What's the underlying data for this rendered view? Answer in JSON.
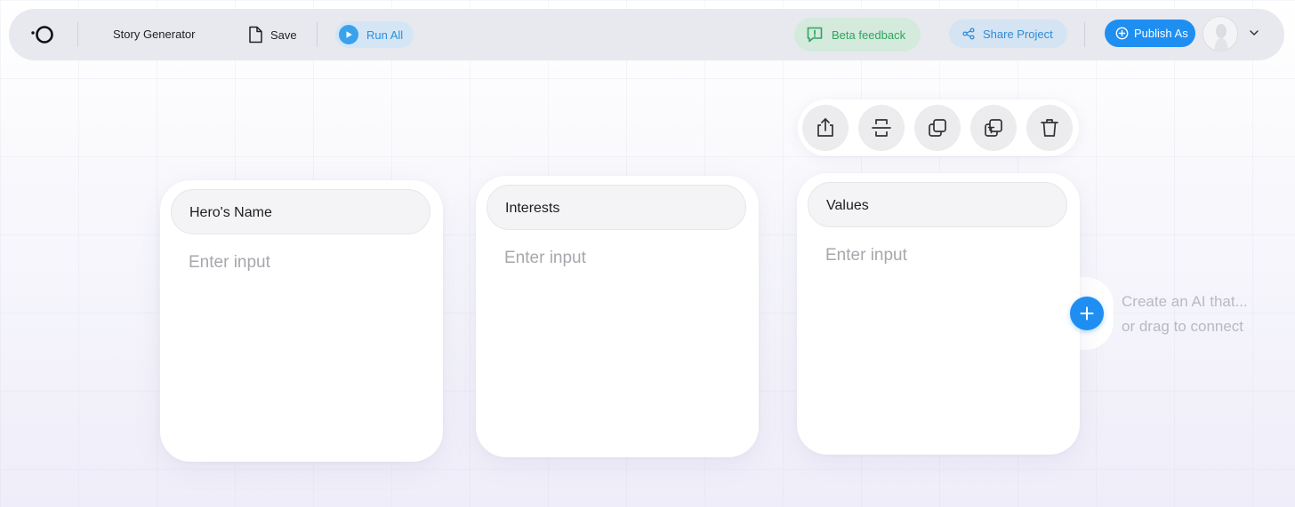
{
  "header": {
    "project_title": "Story Generator",
    "save_label": "Save",
    "run_all_label": "Run All",
    "beta_feedback_label": "Beta feedback",
    "share_label": "Share Project",
    "publish_label": "Publish As"
  },
  "node_toolbar": {
    "tools": [
      "export-icon",
      "split-icon",
      "duplicate-icon",
      "text-copy-icon",
      "trash-icon"
    ]
  },
  "cards": [
    {
      "title": "Hero's Name",
      "placeholder": "Enter input"
    },
    {
      "title": "Interests",
      "placeholder": "Enter input"
    },
    {
      "title": "Values",
      "placeholder": "Enter input"
    }
  ],
  "connector": {
    "hint_line1": "Create an AI that...",
    "hint_line2": "or drag to connect"
  },
  "colors": {
    "accent_blue": "#1f8ef1",
    "beta_green": "#2fa45e",
    "topbar_bg": "#e7e9ef"
  }
}
